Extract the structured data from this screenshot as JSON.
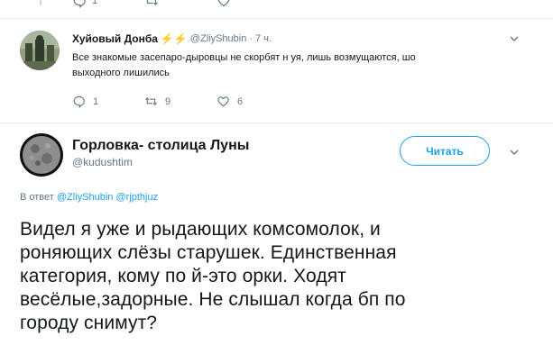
{
  "top_actions": {
    "reply_count": "1",
    "retweet_count": "",
    "like_count": ""
  },
  "reply_tweet": {
    "author_name": "Хуйовый Донба",
    "bolt_emoji": "⚡⚡",
    "handle": "@ZliyShubin",
    "separator": "·",
    "time": "7 ч.",
    "text_line1": "Все знакомые засепаро-дыровцы не скорбят н     уя, лишь возмущаются, шо",
    "text_line2": "выходного лишились",
    "reply_count": "1",
    "retweet_count": "9",
    "like_count": "6"
  },
  "main_tweet": {
    "author_name": "Горловка- столица Луны",
    "handle": "@kudushtim",
    "follow_label": "Читать",
    "replying_prefix": "В ответ",
    "replying_to_1": "@ZliyShubin",
    "replying_to_2": "@rjpthjuz",
    "body_line1": "Видел я уже и рыдающих комсомолок, и",
    "body_line2": "роняющих слёзы старушек. Единственная",
    "body_line3": "категория, кому по     й-это орки. Ходят",
    "body_line4": "весёлые,задорные. Не слышал когда бп по",
    "body_line5": "городу снимут?"
  },
  "icons": {
    "reply": "reply-icon",
    "retweet": "retweet-icon",
    "like": "like-icon",
    "more": "chevron-down-icon"
  },
  "colors": {
    "accent": "#1da1f2",
    "secondary_text": "#657786",
    "divider": "#e6ecf0"
  }
}
